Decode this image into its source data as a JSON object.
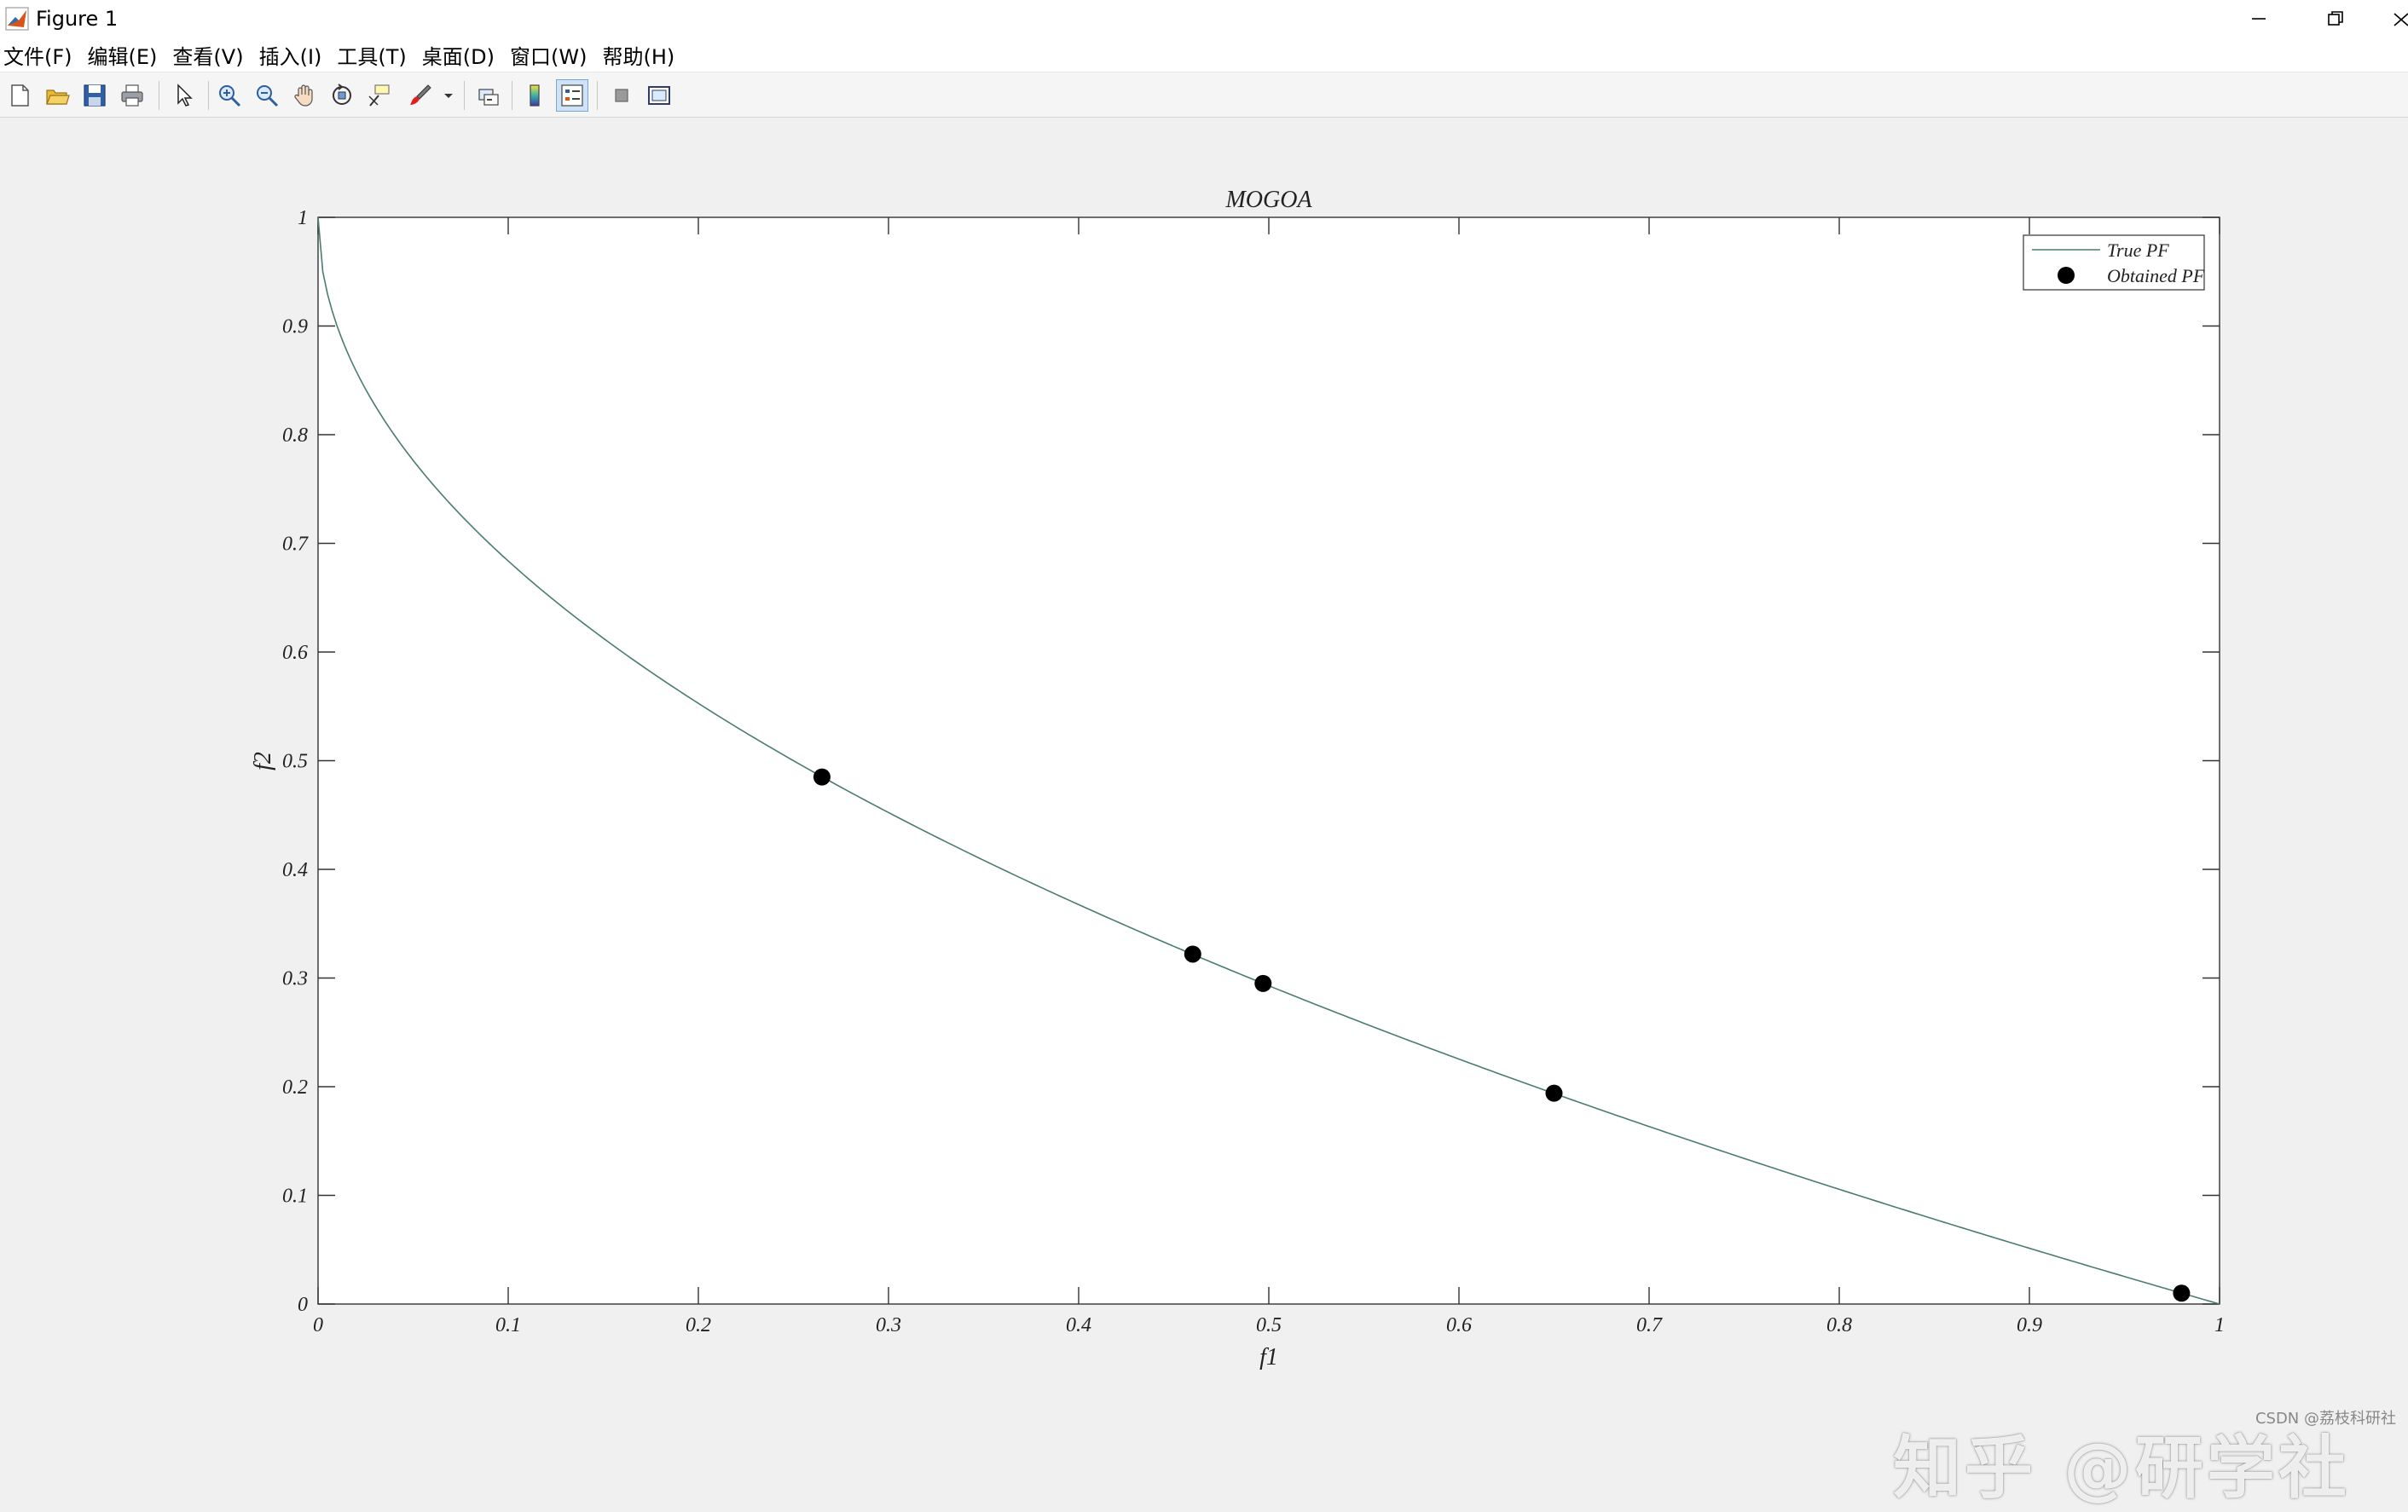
{
  "window": {
    "title": "Figure 1"
  },
  "menu": [
    "文件(F)",
    "编辑(E)",
    "查看(V)",
    "插入(I)",
    "工具(T)",
    "桌面(D)",
    "窗口(W)",
    "帮助(H)"
  ],
  "toolbar": {
    "icons": [
      "new-figure-icon",
      "open-file-icon",
      "save-icon",
      "print-icon",
      "pointer-icon",
      "zoom-in-icon",
      "zoom-out-icon",
      "pan-hand-icon",
      "rotate-3d-icon",
      "data-cursor-icon",
      "brush-icon",
      "link-plot-icon",
      "colorbar-icon",
      "legend-icon",
      "hide-plot-tools-icon",
      "show-plot-tools-icon"
    ],
    "active": "legend-icon"
  },
  "chart_data": {
    "type": "line",
    "title": "MOGOA",
    "xlabel": "f1",
    "ylabel": "f2",
    "xlim": [
      0,
      1
    ],
    "ylim": [
      0,
      1
    ],
    "xticks": [
      "0",
      "0.1",
      "0.2",
      "0.3",
      "0.4",
      "0.5",
      "0.6",
      "0.7",
      "0.8",
      "0.9",
      "1"
    ],
    "yticks": [
      "0",
      "0.1",
      "0.2",
      "0.3",
      "0.4",
      "0.5",
      "0.6",
      "0.7",
      "0.8",
      "0.9",
      "1"
    ],
    "grid": false,
    "legend_position": "top-right",
    "series": [
      {
        "name": "True PF",
        "kind": "line",
        "color": "#4a7c73",
        "curve": "f2 = 1 - sqrt(f1)"
      },
      {
        "name": "Obtained PF",
        "kind": "scatter",
        "color": "#000000",
        "points": [
          [
            0.265,
            0.485
          ],
          [
            0.46,
            0.322
          ],
          [
            0.497,
            0.295
          ],
          [
            0.65,
            0.194
          ],
          [
            0.98,
            0.01
          ]
        ]
      }
    ]
  },
  "watermark": "知乎 @研学社",
  "credit": "CSDN @荔枝科研社"
}
